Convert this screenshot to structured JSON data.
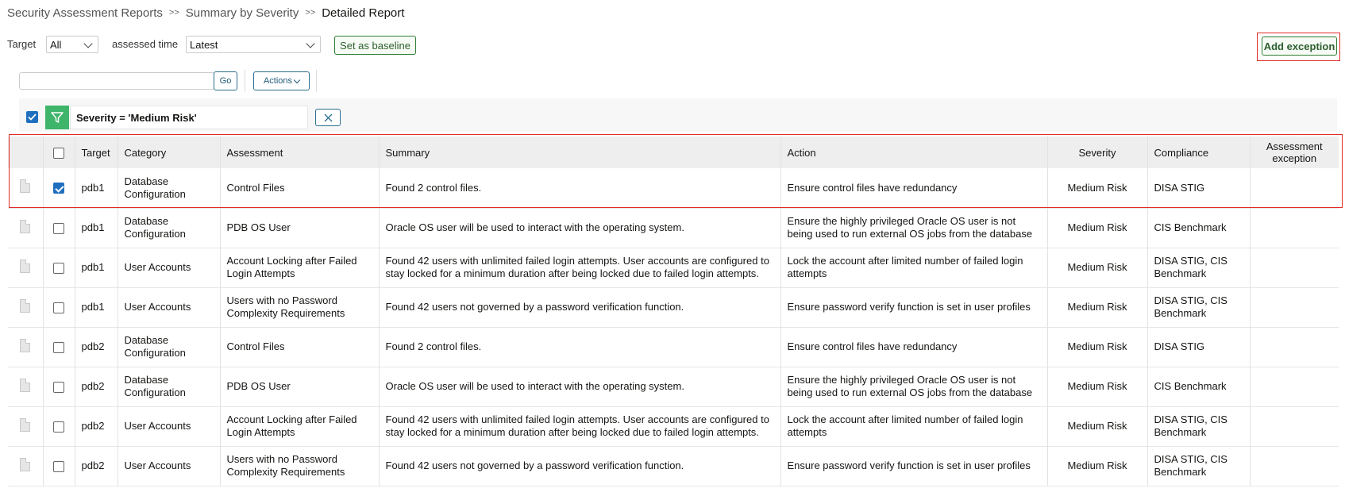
{
  "breadcrumb": {
    "items": [
      "Security Assessment Reports",
      "Summary by Severity",
      "Detailed Report"
    ],
    "separator": ">>"
  },
  "toolbar": {
    "target_label": "Target",
    "target_value": "All",
    "assessed_time_label": "assessed time",
    "assessed_time_value": "Latest",
    "set_baseline_label": "Set as baseline",
    "add_exception_label": "Add exception"
  },
  "search": {
    "value": "",
    "go_label": "Go",
    "actions_label": "Actions"
  },
  "filter": {
    "text": "Severity = 'Medium Risk'",
    "enabled": true
  },
  "table": {
    "headers": [
      "",
      "",
      "Target",
      "Category",
      "Assessment",
      "Summary",
      "Action",
      "Severity",
      "Compliance",
      "Assessment exception"
    ],
    "rows": [
      {
        "checked": true,
        "target": "pdb1",
        "category": "Database Configuration",
        "assessment": "Control Files",
        "summary": "Found 2 control files.",
        "action": "Ensure control files have redundancy",
        "severity": "Medium Risk",
        "compliance": "DISA STIG",
        "exception": ""
      },
      {
        "checked": false,
        "target": "pdb1",
        "category": "Database Configuration",
        "assessment": "PDB OS User",
        "summary": "Oracle OS user will be used to interact with the operating system.",
        "action": "Ensure the highly privileged Oracle OS user is not being used to run external OS jobs from the database",
        "severity": "Medium Risk",
        "compliance": "CIS Benchmark",
        "exception": ""
      },
      {
        "checked": false,
        "target": "pdb1",
        "category": "User Accounts",
        "assessment": "Account Locking after Failed Login Attempts",
        "summary": "Found 42 users with unlimited failed login attempts. User accounts are configured to stay locked for a minimum duration after being locked due to failed login attempts.",
        "action": "Lock the account after limited number of failed login attempts",
        "severity": "Medium Risk",
        "compliance": "DISA STIG, CIS Benchmark",
        "exception": ""
      },
      {
        "checked": false,
        "target": "pdb1",
        "category": "User Accounts",
        "assessment": "Users with no Password Complexity Requirements",
        "summary": "Found 42 users not governed by a password verification function.",
        "action": "Ensure password verify function is set in user profiles",
        "severity": "Medium Risk",
        "compliance": "DISA STIG, CIS Benchmark",
        "exception": ""
      },
      {
        "checked": false,
        "target": "pdb2",
        "category": "Database Configuration",
        "assessment": "Control Files",
        "summary": "Found 2 control files.",
        "action": "Ensure control files have redundancy",
        "severity": "Medium Risk",
        "compliance": "DISA STIG",
        "exception": ""
      },
      {
        "checked": false,
        "target": "pdb2",
        "category": "Database Configuration",
        "assessment": "PDB OS User",
        "summary": "Oracle OS user will be used to interact with the operating system.",
        "action": "Ensure the highly privileged Oracle OS user is not being used to run external OS jobs from the database",
        "severity": "Medium Risk",
        "compliance": "CIS Benchmark",
        "exception": ""
      },
      {
        "checked": false,
        "target": "pdb2",
        "category": "User Accounts",
        "assessment": "Account Locking after Failed Login Attempts",
        "summary": "Found 42 users with unlimited failed login attempts. User accounts are configured to stay locked for a minimum duration after being locked due to failed login attempts.",
        "action": "Lock the account after limited number of failed login attempts",
        "severity": "Medium Risk",
        "compliance": "DISA STIG, CIS Benchmark",
        "exception": ""
      },
      {
        "checked": false,
        "target": "pdb2",
        "category": "User Accounts",
        "assessment": "Users with no Password Complexity Requirements",
        "summary": "Found 42 users not governed by a password verification function.",
        "action": "Ensure password verify function is set in user profiles",
        "severity": "Medium Risk",
        "compliance": "DISA STIG, CIS Benchmark",
        "exception": ""
      }
    ]
  },
  "colors": {
    "accent_blue": "#1f6fbf",
    "green_button": "#2e7d32",
    "filter_green": "#3fb46b",
    "highlight_red": "#e02b27"
  }
}
